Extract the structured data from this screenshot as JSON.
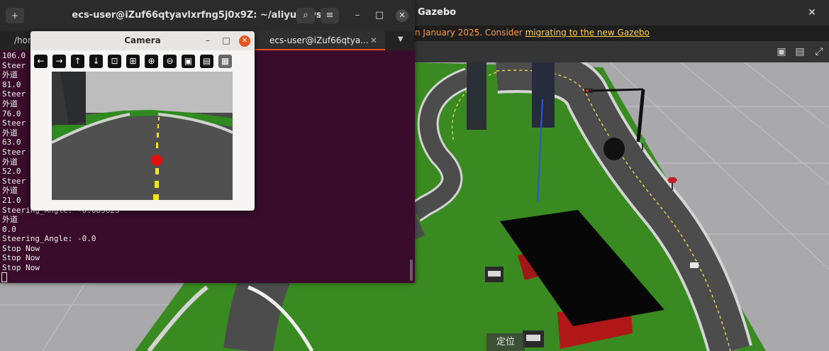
{
  "gazebo": {
    "title": "Gazebo",
    "close_glyph": "✕",
    "notice_prefix": "n January 2025. Consider ",
    "notice_link": "migrating to the new Gazebo",
    "toolbar_icons": [
      "camera-icon",
      "record-icon",
      "expand-icon"
    ],
    "toolbar_glyphs": [
      "▣",
      "▤",
      "⤢"
    ],
    "locate_label": "定位"
  },
  "terminal": {
    "newtab_glyph": "+",
    "title": "ecs-user@iZuf66qtyavlxrfng5j0x9Z: ~/aliyun_ws",
    "search_glyph": "⌕",
    "menu_glyph": "≡",
    "minimize_glyph": "–",
    "maximize_glyph": "□",
    "close_glyph": "✕",
    "tabs": [
      {
        "label": "/hor"
      },
      {
        "label": "ecs-user@iZuf66qtya..."
      }
    ],
    "tab_close_glyph": "✕",
    "tab_menu_glyph": "▼",
    "output": "106.0\nSteer\n外道\n81.0\nSteer\n外道\n76.0\nSteer\n外道\n63.0\nSteer\n外道\n52.0\nSteer\n外道\n21.0\nSteering_Angle: -0.083023\n外道\n0.0\nSteering_Angle: -0.0\nStop Now\nStop Now\nStop Now"
  },
  "camera": {
    "title": "Camera",
    "minimize_glyph": "–",
    "maximize_glyph": "□",
    "close_glyph": "✕",
    "tools": [
      {
        "name": "pan-left-icon",
        "glyph": "←"
      },
      {
        "name": "pan-right-icon",
        "glyph": "→"
      },
      {
        "name": "pan-up-icon",
        "glyph": "↑"
      },
      {
        "name": "pan-down-icon",
        "glyph": "↓"
      },
      {
        "name": "zoom-fit-icon",
        "glyph": "⊡"
      },
      {
        "name": "zoom-original-icon",
        "glyph": "⊞"
      },
      {
        "name": "zoom-in-icon",
        "glyph": "⊕"
      },
      {
        "name": "zoom-out-icon",
        "glyph": "⊖"
      },
      {
        "name": "save-icon",
        "glyph": "▣"
      },
      {
        "name": "copy-icon",
        "glyph": "▤"
      },
      {
        "name": "settings-icon",
        "glyph": "▦"
      }
    ]
  }
}
